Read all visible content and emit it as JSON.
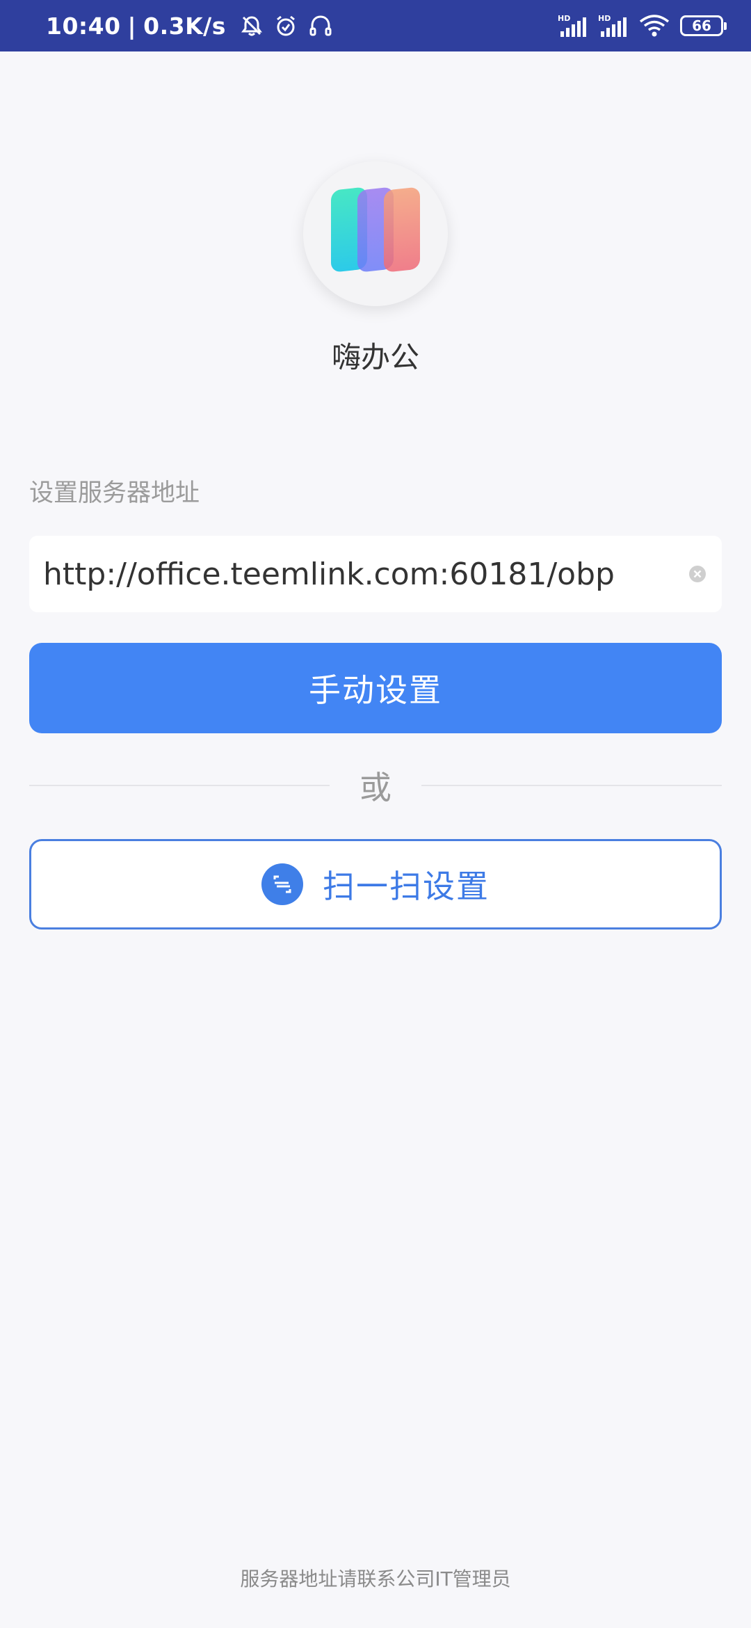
{
  "status_bar": {
    "time": "10:40",
    "separator": "|",
    "net_speed": "0.3K/s",
    "left_icons": [
      "bell-off-icon",
      "alarm-icon",
      "headphones-icon"
    ],
    "signal_1_label": "HD",
    "signal_2_label": "HD",
    "battery": "66"
  },
  "app": {
    "name": "嗨办公",
    "logo_colors": [
      "#2fe0c6",
      "#8a7cf6",
      "#f3866a"
    ]
  },
  "server": {
    "label": "设置服务器地址",
    "url": "http://office.teemlink.com:60181/obp"
  },
  "buttons": {
    "manual": "手动设置",
    "or": "或",
    "scan": "扫一扫设置"
  },
  "footer": {
    "note": "服务器地址请联系公司IT管理员"
  },
  "colors": {
    "status_bar": "#2f3f9e",
    "primary": "#4285f4",
    "scan_accent": "#3d7ae6"
  }
}
